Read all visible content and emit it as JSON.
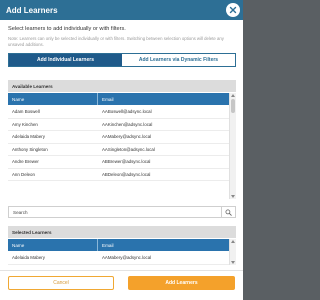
{
  "dialog": {
    "title": "Add Learners",
    "close_icon": "close-icon"
  },
  "intro_text": "Select learners to add individually or with filters.",
  "note_text": "Note: Learners can only be selected individually or with filters. Switching between selection options will delete any unsaved additions.",
  "tabs": [
    {
      "label": "Add Individual Learners",
      "active": true
    },
    {
      "label": "Add Learners via Dynamic Filters",
      "active": false
    }
  ],
  "available": {
    "title": "Available Learners",
    "columns": [
      "Name",
      "Email"
    ],
    "rows": [
      {
        "name": "Adam Boswell",
        "email": "AABoswell@adsync.local"
      },
      {
        "name": "Amy Kinchen",
        "email": "AAKinchen@adsync.local"
      },
      {
        "name": "Adelaida Mabery",
        "email": "AAMabery@adsync.local"
      },
      {
        "name": "Anthony Singleton",
        "email": "AASingleton@adsync.local"
      },
      {
        "name": "Andre Brewer",
        "email": "ABBrewer@adsync.local"
      },
      {
        "name": "Ann Deleon",
        "email": "ABDeleon@adsync.local"
      }
    ]
  },
  "search": {
    "placeholder": "Search",
    "icon": "search-icon"
  },
  "selected": {
    "title": "Selected Learners",
    "columns": [
      "Name",
      "Email"
    ],
    "rows": [
      {
        "name": "Adelaida Mabery",
        "email": "AAMabery@adsync.local"
      }
    ]
  },
  "buttons": {
    "cancel": "Cancel",
    "add": "Add Learners"
  },
  "colors": {
    "header": "#2d6f95",
    "tab_active": "#1f5a8a",
    "grid_header": "#2a73ad",
    "accent": "#f4a12b"
  }
}
